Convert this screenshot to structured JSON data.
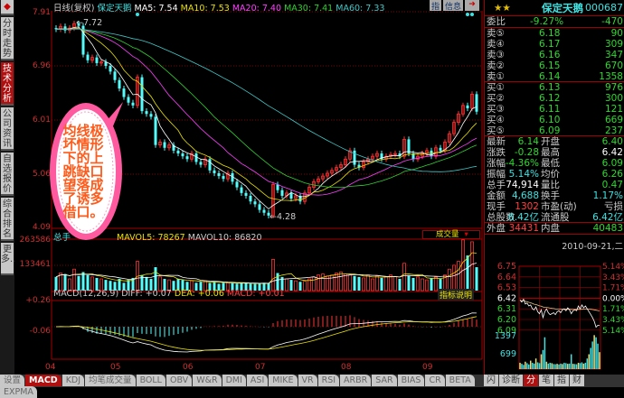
{
  "sidebar": {
    "items": [
      {
        "label": "分时走势"
      },
      {
        "label": "技术分析",
        "active": true
      },
      {
        "label": "公司资讯"
      },
      {
        "label": "自选报价"
      },
      {
        "label": "综合排名"
      },
      {
        "label": "更多.."
      }
    ]
  },
  "header": {
    "period": "日线(复权)",
    "stock_name": "保定天鹅",
    "ma5": "MA5: 7.54",
    "ma10": "MA10: 7.53",
    "ma20": "MA20: 7.40",
    "ma30": "MA30: 7.41",
    "ma60": "MA60: 7.33",
    "btn_zhi": "指",
    "btn_info": "信息"
  },
  "price_axis": [
    "7.91",
    "6.96",
    "6.01",
    "5.06",
    "4.09"
  ],
  "annotations": {
    "high": "7.72",
    "low": "4.28"
  },
  "volume": {
    "label": "总手",
    "mavol5": "MAVOL5: 78267",
    "mavol10": "MAVOL10: 86820",
    "axis": [
      "263586",
      "133461"
    ],
    "selector": "成交量"
  },
  "macd": {
    "label": "MACD(12,26,9)",
    "diff": "DIFF: +0.07",
    "dea": "DEA: +0.06",
    "macd": "MACD: +0.01",
    "axis": [
      "+0.26",
      "-0.06"
    ],
    "help": "指标说明"
  },
  "x_axis": [
    "04",
    "05",
    "06",
    "07",
    "08",
    "09"
  ],
  "callout": {
    "lines": [
      "均线极",
      "坏情形",
      "下的上",
      "跳缺口",
      "望落成",
      "了诱多",
      "借口。"
    ]
  },
  "colors": {
    "up": "#ff3232",
    "down": "#54fcfc",
    "ma5": "#ffffff",
    "ma10": "#e8e000",
    "ma20": "#ff40ff",
    "ma30": "#30d030",
    "ma60": "#40c8c8",
    "grid": "#800000"
  },
  "chart_data": {
    "type": "candlestick",
    "ylim": [
      4.09,
      7.91
    ],
    "closes": [
      7.6,
      7.65,
      7.58,
      7.62,
      7.7,
      7.66,
      7.15,
      7.05,
      7.1,
      7.0,
      7.02,
      6.95,
      6.85,
      6.7,
      6.55,
      6.4,
      6.3,
      6.25,
      6.75,
      6.15,
      6.1,
      6.05,
      5.55,
      5.6,
      5.5,
      5.55,
      5.45,
      5.4,
      5.35,
      5.3,
      5.4,
      5.25,
      5.2,
      5.3,
      5.1,
      5.05,
      5.0,
      4.95,
      5.05,
      4.9,
      4.8,
      4.7,
      4.65,
      4.55,
      4.5,
      4.4,
      4.35,
      4.3,
      4.85,
      4.75,
      4.65,
      4.7,
      4.6,
      4.65,
      4.55,
      4.7,
      4.8,
      4.9,
      4.95,
      5.0,
      5.05,
      5.1,
      5.15,
      5.2,
      5.3,
      5.45,
      5.2,
      5.15,
      5.25,
      5.3,
      5.35,
      5.4,
      5.3,
      5.35,
      5.38,
      5.4,
      5.35,
      5.65,
      5.4,
      5.3,
      5.35,
      5.4,
      5.45,
      5.35,
      5.5,
      5.45,
      5.6,
      5.75,
      5.95,
      6.1,
      6.25,
      6.2,
      6.45,
      6.14
    ],
    "volumes": [
      70000,
      90000,
      85000,
      60000,
      110000,
      75000,
      95000,
      80000,
      70000,
      65000,
      60000,
      55000,
      50000,
      45000,
      60000,
      40000,
      55000,
      65000,
      150000,
      80000,
      70000,
      60000,
      120000,
      70000,
      60000,
      55000,
      50000,
      60000,
      55000,
      45000,
      50000,
      40000,
      45000,
      50000,
      40000,
      45000,
      35000,
      40000,
      42000,
      38000,
      35000,
      40000,
      38000,
      36000,
      34000,
      35000,
      40000,
      38000,
      160000,
      90000,
      70000,
      60000,
      55000,
      50000,
      45000,
      48000,
      60000,
      70000,
      80000,
      85000,
      75000,
      80000,
      90000,
      95000,
      85000,
      80000,
      75000,
      70000,
      65000,
      80000,
      60000,
      75000,
      65000,
      70000,
      80000,
      72000,
      60000,
      140000,
      75000,
      65000,
      70000,
      60000,
      55000,
      65000,
      70000,
      60000,
      80000,
      110000,
      130000,
      150000,
      260000,
      180000,
      250000,
      120000
    ],
    "volume_ylim": [
      0,
      263586
    ]
  },
  "quote": {
    "stars": "★★",
    "name": "保定天鹅",
    "code": "000687",
    "weibi": {
      "label": "委比",
      "pct": "-9.27%",
      "diff": "-470"
    },
    "sells": [
      {
        "label": "卖⑤",
        "price": "6.18",
        "vol": "90"
      },
      {
        "label": "卖④",
        "price": "6.17",
        "vol": "309"
      },
      {
        "label": "卖③",
        "price": "6.16",
        "vol": "347"
      },
      {
        "label": "卖②",
        "price": "6.15",
        "vol": "670"
      },
      {
        "label": "卖①",
        "price": "6.14",
        "vol": "1358"
      }
    ],
    "buys": [
      {
        "label": "买①",
        "price": "6.13",
        "vol": "976"
      },
      {
        "label": "买②",
        "price": "6.12",
        "vol": "300"
      },
      {
        "label": "买③",
        "price": "6.11",
        "vol": "121"
      },
      {
        "label": "买④",
        "price": "6.10",
        "vol": "669"
      },
      {
        "label": "买⑤",
        "price": "6.09",
        "vol": "237"
      }
    ],
    "stats": [
      {
        "l1": "最新",
        "v1": "6.14",
        "c1": "green",
        "l2": "开盘",
        "v2": "6.40",
        "c2": "green"
      },
      {
        "l1": "涨跌",
        "v1": "-0.28",
        "c1": "green",
        "l2": "最高",
        "v2": "6.42",
        "c2": "white"
      },
      {
        "l1": "涨幅",
        "v1": "-4.36%",
        "c1": "green",
        "l2": "最低",
        "v2": "6.09",
        "c2": "green"
      },
      {
        "l1": "振幅",
        "v1": "5.14%",
        "c1": "cyan",
        "l2": "均价",
        "v2": "6.26",
        "c2": "green"
      },
      {
        "l1": "总手",
        "v1": "74,914",
        "c1": "white",
        "l2": "量比",
        "v2": "0.47",
        "c2": "green"
      },
      {
        "l1": "金额",
        "v1": "4,688",
        "c1": "cyan",
        "l2": "换手",
        "v2": "1.17%",
        "c2": "cyan"
      },
      {
        "l1": "现手",
        "v1": "1302",
        "c1": "red",
        "l2": "市盈(动)",
        "v2": "亏损",
        "c2": "lab2"
      },
      {
        "l1": "总股数",
        "v1": "6.42亿",
        "c1": "cyan",
        "l2": "流通股",
        "v2": "6.42亿",
        "c2": "cyan"
      }
    ],
    "outer": {
      "label": "外盘",
      "value": "34431"
    },
    "inner": {
      "label": "内盘",
      "value": "40483"
    },
    "date": "2010-09-21,二"
  },
  "intraday": {
    "left_axis": [
      "6.75",
      "6.64",
      "6.53",
      "6.42",
      "6.31",
      "6.20",
      "6.09"
    ],
    "right_axis": [
      "5.14%",
      "3.43%",
      "1.71%",
      "0.00%",
      "1.71%",
      "3.43%",
      "5.14%"
    ],
    "vol_axis": [
      "1397",
      "699"
    ],
    "prices": [
      6.4,
      6.38,
      6.41,
      6.36,
      6.37,
      6.34,
      6.35,
      6.31,
      6.3,
      6.33,
      6.28,
      6.26,
      6.3,
      6.22,
      6.28,
      6.31,
      6.27,
      6.25,
      6.26,
      6.27,
      6.25,
      6.28,
      6.29,
      6.27,
      6.3,
      6.31,
      6.29,
      6.32,
      6.3,
      6.26,
      6.29,
      6.3,
      6.29,
      6.34,
      6.31,
      6.35,
      6.32,
      6.34,
      6.31,
      6.28,
      6.25,
      6.22,
      6.18,
      6.12,
      6.14,
      6.14
    ],
    "volumes": [
      300,
      250,
      200,
      350,
      280,
      220,
      400,
      300,
      260,
      500,
      320,
      280,
      700,
      900,
      1500,
      350,
      260,
      300,
      280,
      240,
      230,
      250,
      220,
      260,
      240,
      300,
      280,
      250,
      260,
      700,
      250,
      240,
      230,
      300,
      280,
      320,
      260,
      300,
      500,
      700,
      1000,
      1300,
      1600,
      1500,
      1200,
      800
    ]
  },
  "bottom_tabs": [
    "设置",
    "MACD",
    "KDJ",
    "均笔成交量",
    "BOLL",
    "OBV",
    "W&R",
    "DMI",
    "ASI",
    "MIKE",
    "VR",
    "RSI",
    "ARBR",
    "SAR",
    "BIAS",
    "CR",
    "BETA",
    "EXPMA"
  ],
  "right_tabs": [
    "闪",
    "诊断",
    "分",
    "笔",
    "指",
    "财"
  ]
}
